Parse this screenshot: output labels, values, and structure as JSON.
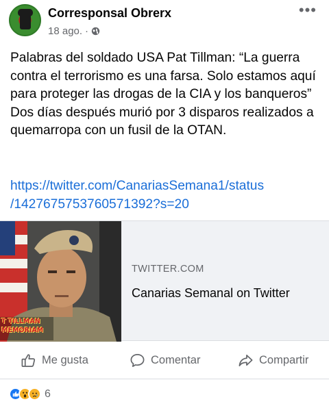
{
  "post": {
    "author": "Corresponsal Obrerx",
    "date": "18 ago.",
    "separator": "·",
    "visibility_icon": "globe-icon",
    "more_icon": "more-options-icon",
    "more_label": "•••",
    "text": "Palabras del soldado USA Pat Tillman: “La guerra contra el terrorismo es una farsa. Solo estamos aquí para proteger las drogas de la CIA y los banqueros” Dos días después murió por 3 disparos realizados a quemarropa con un fusil de la OTAN.",
    "link_line1": "https://twitter.com/CanariasSemana1/status",
    "link_line2": "/1427675753760571392?s=20"
  },
  "preview": {
    "domain": "TWITTER.COM",
    "title": "Canarias Semanal on Twitter",
    "image_caption_line1": "T TILLMAN",
    "image_caption_line2": "MEMORIAM"
  },
  "actions": {
    "like": "Me gusta",
    "comment": "Comentar",
    "share": "Compartir"
  },
  "reactions": {
    "icons": [
      "like-reaction-icon",
      "wow-reaction-icon",
      "sad-reaction-icon"
    ],
    "count": "6"
  },
  "colors": {
    "link": "#1a6ed8",
    "secondary_text": "#65676b",
    "like_blue": "#1877f2",
    "reaction_yellow": "#f7b125"
  }
}
